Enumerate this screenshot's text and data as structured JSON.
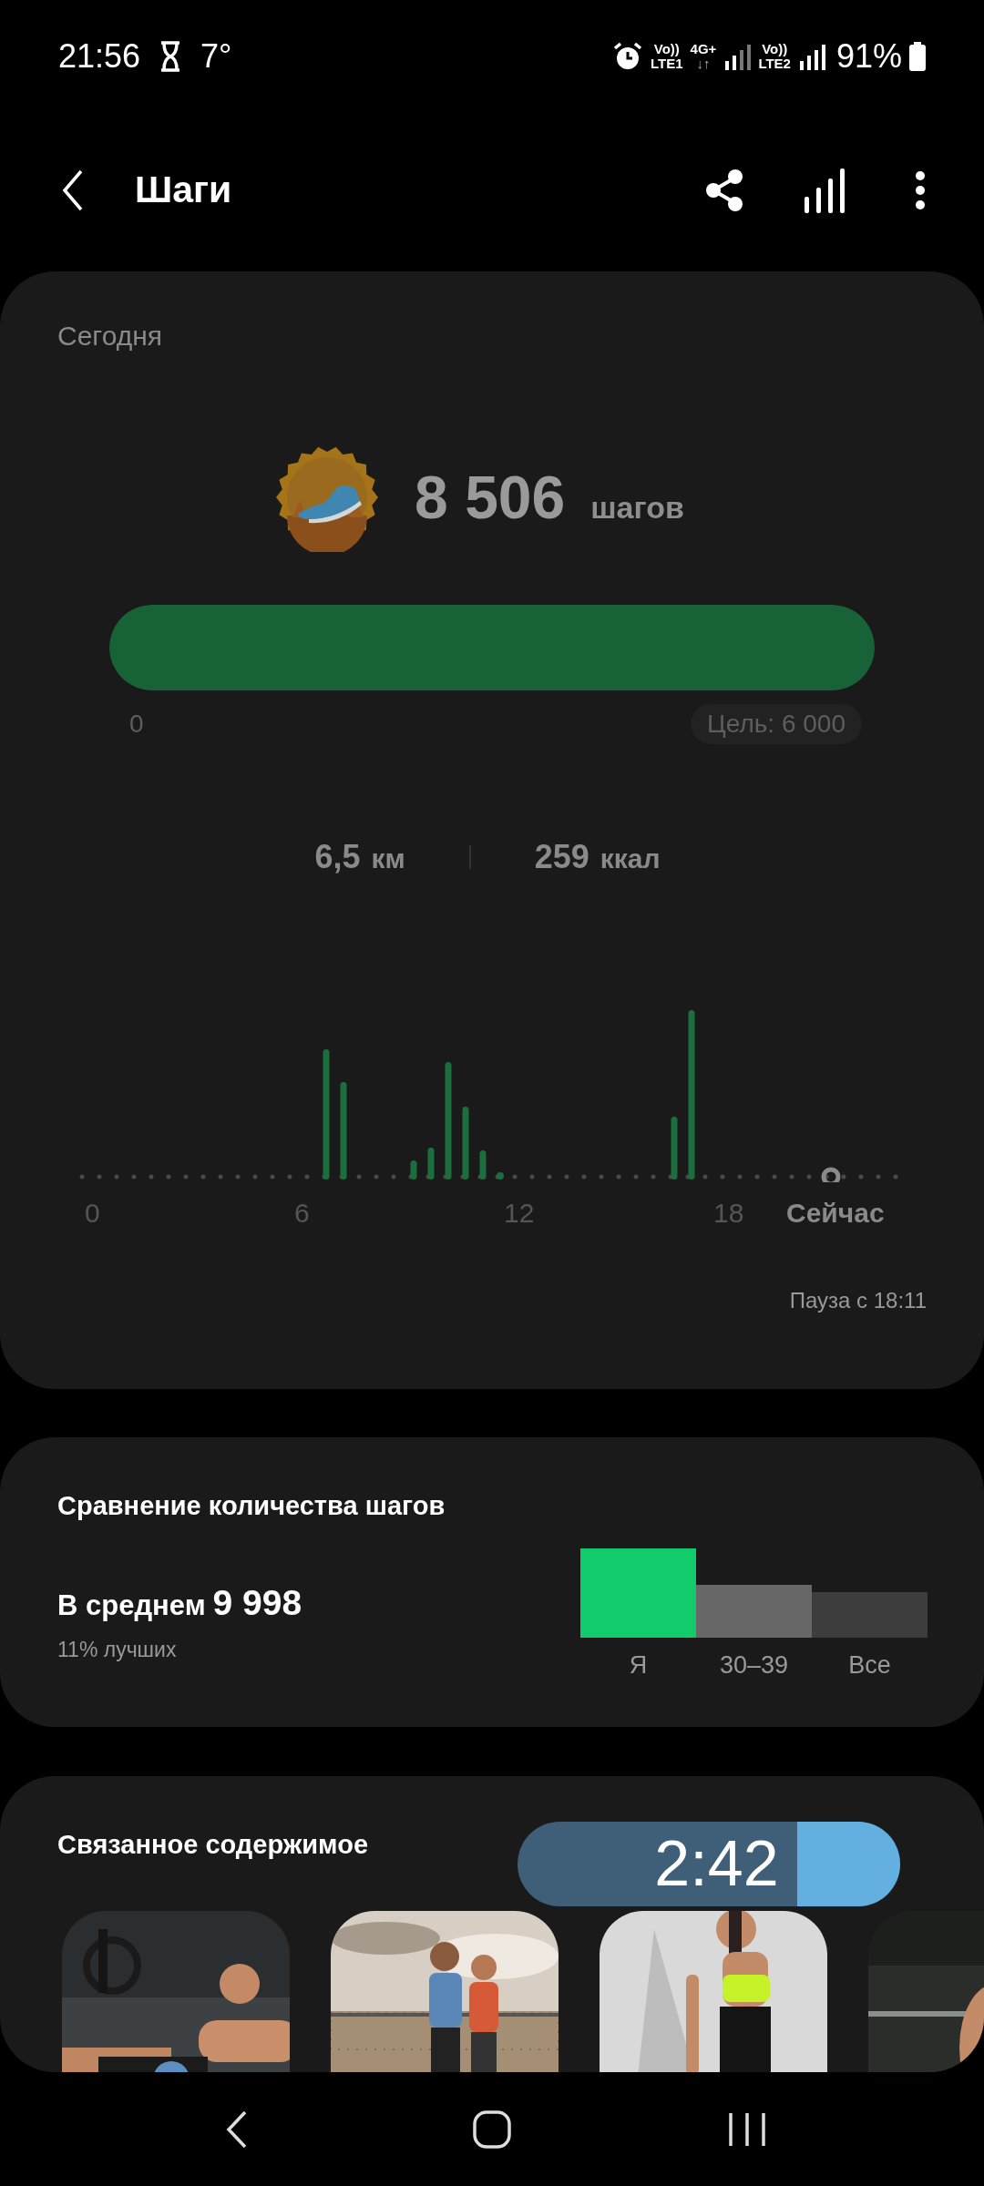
{
  "status_bar": {
    "time": "21:56",
    "temperature": "7°",
    "sim1_top": "Vo))",
    "sim1_label": "LTE1",
    "data_type": "4G+",
    "data_arrows": "↓↑",
    "sim2_top": "Vo))",
    "sim2_label": "LTE2",
    "battery": "91%"
  },
  "header": {
    "title": "Шаги"
  },
  "today": {
    "label": "Сегодня",
    "steps": "8 506",
    "unit": "шагов",
    "progress": {
      "level": 1,
      "start": "0",
      "goal": "Цель: 6 000"
    },
    "distance": {
      "value": "6,5",
      "unit": "км"
    },
    "calories": {
      "value": "259",
      "unit": "ккал"
    },
    "hour_axis": [
      "0",
      "6",
      "12",
      "18",
      "Сейчас"
    ],
    "pause_note": "Пауза с 18:11"
  },
  "comparison": {
    "title": "Сравнение количества шагов",
    "average_label": "В среднем",
    "average_value": "9 998",
    "rank": "11% лучших",
    "groups": [
      {
        "label": "Я",
        "color": "#12cc6c"
      },
      {
        "label": "30–39",
        "color": "#676767"
      },
      {
        "label": "Все",
        "color": "#3d3d3d"
      }
    ]
  },
  "related": {
    "title": "Связанное содержимое"
  },
  "timer": {
    "text": "2:42",
    "level": 0.27
  }
}
